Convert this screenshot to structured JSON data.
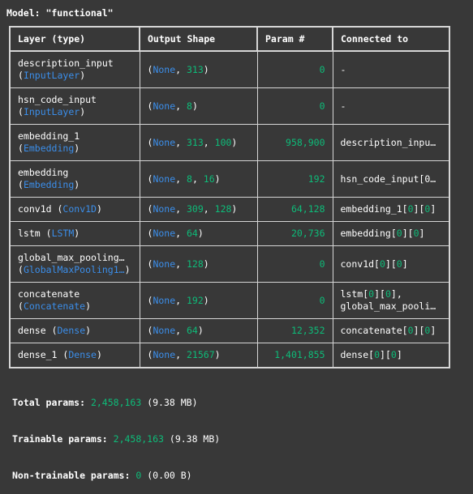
{
  "model_title": "Model: \"functional\"",
  "headers": {
    "layer": "Layer (type)",
    "shape": "Output Shape",
    "param": "Param #",
    "conn": "Connected to"
  },
  "rows": [
    {
      "name": "description_input",
      "cls": "InputLayer",
      "shape": [
        "313"
      ],
      "param": "0",
      "conn": [
        "-"
      ]
    },
    {
      "name": "hsn_code_input",
      "cls": "InputLayer",
      "shape": [
        "8"
      ],
      "param": "0",
      "conn": [
        "-"
      ]
    },
    {
      "name": "embedding_1",
      "cls": "Embedding",
      "shape": [
        "313",
        "100"
      ],
      "param": "958,900",
      "conn": [
        "description_inpu…"
      ]
    },
    {
      "name": "embedding",
      "cls": "Embedding",
      "shape": [
        "8",
        "16"
      ],
      "param": "192",
      "conn": [
        "hsn_code_input[0…"
      ]
    },
    {
      "name": "conv1d",
      "cls": "Conv1D",
      "shape": [
        "309",
        "128"
      ],
      "param": "64,128",
      "conn": [
        "embedding_1[0][0]"
      ]
    },
    {
      "name": "lstm",
      "cls": "LSTM",
      "shape": [
        "64"
      ],
      "param": "20,736",
      "conn": [
        "embedding[0][0]"
      ]
    },
    {
      "name": "global_max_pooling…",
      "cls": "GlobalMaxPooling1…",
      "shape": [
        "128"
      ],
      "param": "0",
      "conn": [
        "conv1d[0][0]"
      ]
    },
    {
      "name": "concatenate",
      "cls": "Concatenate",
      "shape": [
        "192"
      ],
      "param": "0",
      "conn": [
        "lstm[0][0],",
        "global_max_pooli…"
      ]
    },
    {
      "name": "dense",
      "cls": "Dense",
      "shape": [
        "64"
      ],
      "param": "12,352",
      "conn": [
        "concatenate[0][0]"
      ]
    },
    {
      "name": "dense_1",
      "cls": "Dense",
      "shape": [
        "21567"
      ],
      "param": "1,401,855",
      "conn": [
        "dense[0][0]"
      ]
    }
  ],
  "totals": {
    "total": {
      "label": "Total params:",
      "value": "2,458,163",
      "size": "(9.38 MB)"
    },
    "trainable": {
      "label": "Trainable params:",
      "value": "2,458,163",
      "size": "(9.38 MB)"
    },
    "non_trainable": {
      "label": "Non-trainable params:",
      "value": "0",
      "size": "(0.00 B)"
    }
  },
  "colors": {
    "background": "#383838",
    "text": "#ffffff",
    "type_blue": "#3b8eea",
    "number_green": "#0dbc79",
    "border": "#d6d6d6"
  }
}
